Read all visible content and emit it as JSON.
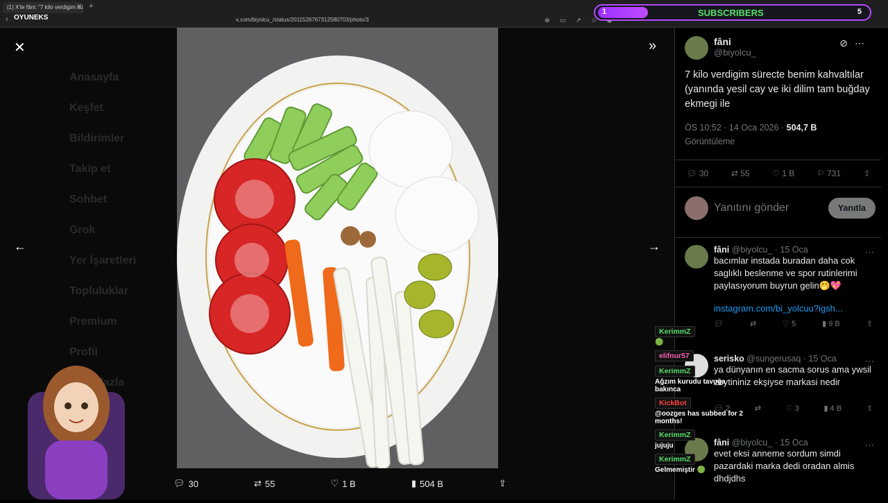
{
  "browser": {
    "tab_title": "(1) X'te fâni: \"7 kilo verdigim sür...",
    "url": "x.com/biyolcu_/status/2011526767312580703/photo/3",
    "logo": "OYUNEKS"
  },
  "overlay": {
    "subs_count": "1",
    "subs_label": "SUBSCRIBERS",
    "subs_goal": "5"
  },
  "background_nav": [
    "Anasayfa",
    "Keşfet",
    "Bildirimler",
    "Takip et",
    "Sohbet",
    "Grok",
    "Yer İşaretleri",
    "Topluluklar",
    "Premium",
    "Profil",
    "Daha fazla"
  ],
  "photo_stats": {
    "replies": "30",
    "reposts": "55",
    "likes": "1 B",
    "views": "504 B"
  },
  "tweet": {
    "name": "fâni",
    "handle": "@biyolcu_",
    "text": "7 kilo verdigim sürecte benim kahvaltılar (yanında yesil cay ve iki dilim tam buğday ekmegi ile",
    "time": "ÖS 10:52 · 14 Oca 2026 · ",
    "views": "504,7 B",
    "views_label": "Görüntüleme",
    "replies": "30",
    "reposts": "55",
    "likes": "1 B",
    "bookmarks": "731"
  },
  "reply": {
    "placeholder": "Yanıtını gönder",
    "button": "Yanıtla"
  },
  "comments": [
    {
      "name": "fâni",
      "handle": "@biyolcu_ · 15 Oca",
      "text": "bacımlar instada buradan daha cok saglıklı beslenme ve spor rutinlerimi paylasıyorum buyrun gelin🤭💖",
      "link": "instagram.com/bi_yolcuu?igsh...",
      "likes": "5",
      "views": "9 B"
    },
    {
      "name": "serisko",
      "handle": "@sungerusaq · 15 Oca",
      "text": "ya dünyanın en sacma sorus ama ywsil zeytininiz ekşiyse markasi nedir",
      "replies": "2",
      "likes": "3",
      "views": "4 B"
    },
    {
      "name": "fâni",
      "handle": "@biyolcu_ · 15 Oca",
      "text": "evet eksi anneme sordum simdi pazardaki marka dedi oradan almis dhdjdhs"
    }
  ],
  "chat": [
    {
      "user": "KerimmZ",
      "msg": "🟢",
      "style": "green"
    },
    {
      "user": "elifnur57",
      "msg": "",
      "style": "green"
    },
    {
      "user": "KerimmZ",
      "msg": "Ağzım kurudu tavuğa bakınca",
      "style": "green"
    },
    {
      "user": "KickBot",
      "msg": "@oozges has subbed for 2 months!",
      "style": "red"
    },
    {
      "user": "KerimmZ",
      "msg": "jujuju",
      "style": "green"
    },
    {
      "user": "KerimmZ",
      "msg": "Gelmemiştir 🟢",
      "style": "green"
    }
  ],
  "colors": {
    "accent": "#1d9bf0",
    "chat_green": "#58e06a",
    "subs_border": "#b44bff"
  }
}
